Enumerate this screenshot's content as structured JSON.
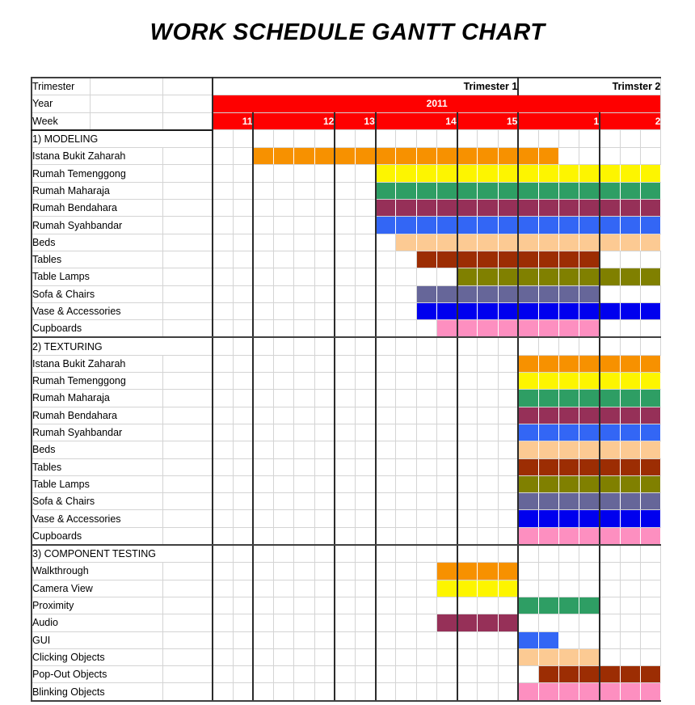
{
  "title": "WORK SCHEDULE GANTT CHART",
  "header": {
    "row_labels": [
      "Trimester",
      "Year",
      "Week"
    ],
    "trimesters": [
      {
        "label": "Trimester 1",
        "span_weeks": [
          "11",
          "12",
          "13",
          "14",
          "15"
        ]
      },
      {
        "label": "Trimster 2",
        "span_weeks": [
          "1",
          "2"
        ]
      }
    ],
    "year": "2011",
    "weeks": [
      "11",
      "12",
      "13",
      "14",
      "15",
      "1",
      "2"
    ],
    "week_widths": [
      2,
      4,
      2,
      4,
      3,
      4,
      3
    ],
    "header_color": "#fe0000",
    "header_text_color": "#ffffff"
  },
  "grid": {
    "total_subcolumns": 22,
    "week_boundary_after": [
      2,
      6,
      8,
      12,
      15,
      19,
      22
    ]
  },
  "sections": [
    {
      "heading": "1) MODELING",
      "rows": [
        {
          "label": "Istana Bukit Zaharah",
          "color": "#f79100",
          "start": 3,
          "end": 17
        },
        {
          "label": "Rumah Temenggong",
          "color": "#fdf500",
          "start": 9,
          "end": 22
        },
        {
          "label": "Rumah Maharaja",
          "color": "#2e9e64",
          "start": 9,
          "end": 22
        },
        {
          "label": "Rumah Bendahara",
          "color": "#963058",
          "start": 9,
          "end": 22
        },
        {
          "label": "Rumah Syahbandar",
          "color": "#3366f5",
          "start": 9,
          "end": 22
        },
        {
          "label": "Beds",
          "color": "#fcca93",
          "start": 10,
          "end": 22
        },
        {
          "label": "Tables",
          "color": "#9c2d03",
          "start": 11,
          "end": 19
        },
        {
          "label": "Table Lamps",
          "color": "#808000",
          "start": 13,
          "end": 22
        },
        {
          "label": "Sofa & Chairs",
          "color": "#666699",
          "start": 11,
          "end": 19
        },
        {
          "label": "Vase & Accessories",
          "color": "#0000ee",
          "start": 11,
          "end": 22
        },
        {
          "label": "Cupboards",
          "color": "#fd8fc0",
          "start": 12,
          "end": 19
        }
      ]
    },
    {
      "heading": "2) TEXTURING",
      "rows": [
        {
          "label": "Istana Bukit Zaharah",
          "color": "#f79100",
          "start": 16,
          "end": 22
        },
        {
          "label": "Rumah Temenggong",
          "color": "#fdf500",
          "start": 16,
          "end": 22
        },
        {
          "label": "Rumah Maharaja",
          "color": "#2e9e64",
          "start": 16,
          "end": 22
        },
        {
          "label": "Rumah Bendahara",
          "color": "#963058",
          "start": 16,
          "end": 22
        },
        {
          "label": "Rumah Syahbandar",
          "color": "#3366f5",
          "start": 16,
          "end": 22
        },
        {
          "label": "Beds",
          "color": "#fcca93",
          "start": 16,
          "end": 22
        },
        {
          "label": "Tables",
          "color": "#9c2d03",
          "start": 16,
          "end": 22
        },
        {
          "label": "Table Lamps",
          "color": "#808000",
          "start": 16,
          "end": 22
        },
        {
          "label": "Sofa & Chairs",
          "color": "#666699",
          "start": 16,
          "end": 22
        },
        {
          "label": "Vase & Accessories",
          "color": "#0000ee",
          "start": 16,
          "end": 22
        },
        {
          "label": "Cupboards",
          "color": "#fd8fc0",
          "start": 16,
          "end": 22
        }
      ]
    },
    {
      "heading": "3) COMPONENT TESTING",
      "rows": [
        {
          "label": "Walkthrough",
          "color": "#f79100",
          "start": 12,
          "end": 15
        },
        {
          "label": "Camera View",
          "color": "#fdf500",
          "start": 12,
          "end": 15
        },
        {
          "label": "Proximity",
          "color": "#2e9e64",
          "start": 16,
          "end": 19
        },
        {
          "label": "Audio",
          "color": "#963058",
          "start": 12,
          "end": 15
        },
        {
          "label": "GUI",
          "color": "#3366f5",
          "start": 16,
          "end": 17
        },
        {
          "label": "Clicking Objects",
          "color": "#fcca93",
          "start": 16,
          "end": 19
        },
        {
          "label": "Pop-Out Objects",
          "color": "#9c2d03",
          "start": 17,
          "end": 22
        },
        {
          "label": "Blinking Objects",
          "color": "#fd8fc0",
          "start": 16,
          "end": 22
        }
      ]
    }
  ]
}
